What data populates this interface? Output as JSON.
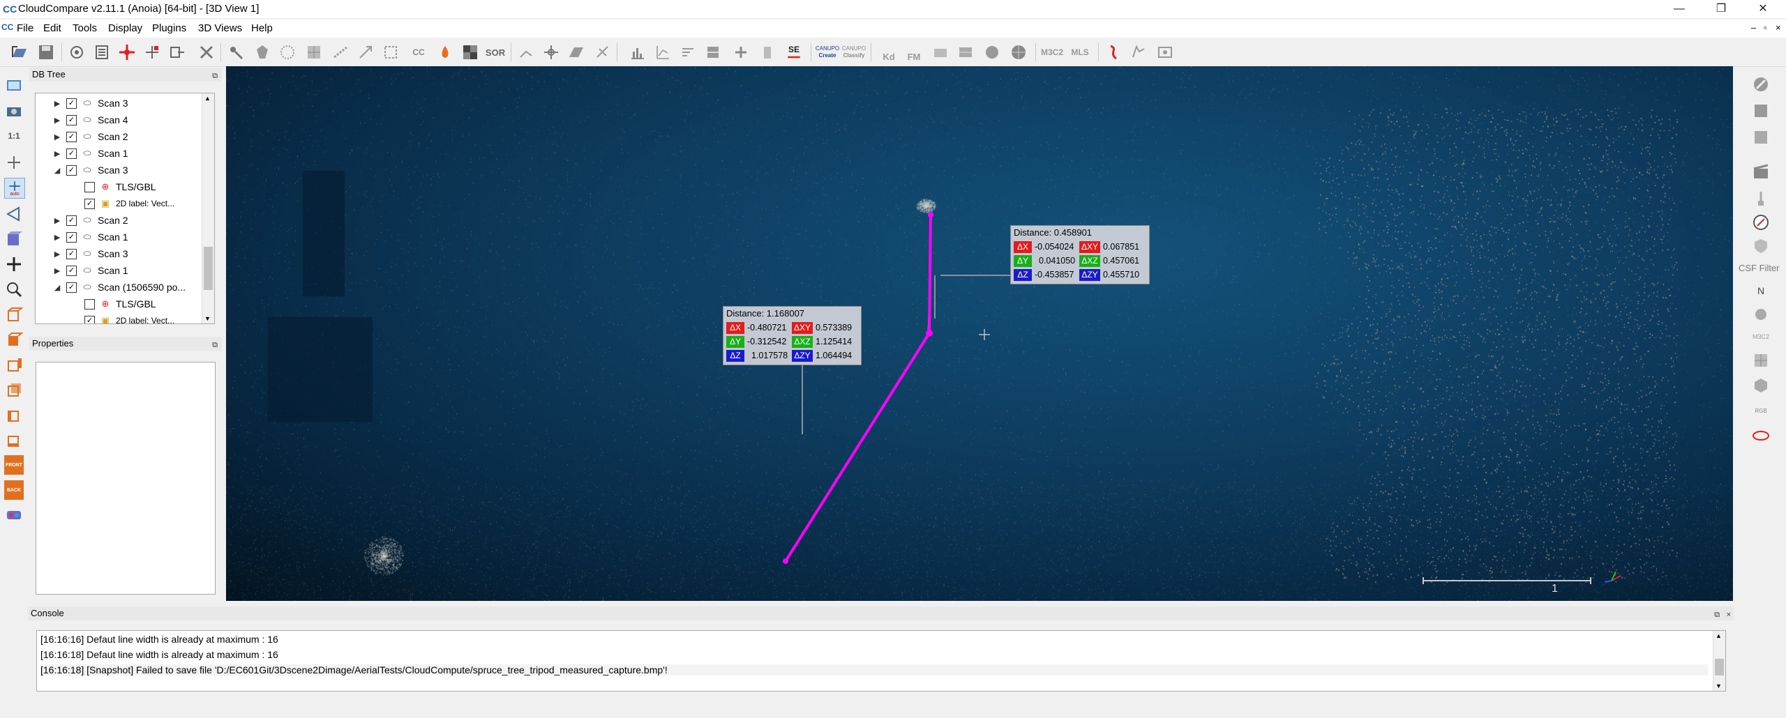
{
  "window": {
    "title": "CloudCompare v2.11.1 (Anoia) [64-bit] - [3D View 1]",
    "app_icon": "CC",
    "minimize": "—",
    "maximize": "❐",
    "close": "✕"
  },
  "menu": {
    "items": [
      "File",
      "Edit",
      "Tools",
      "Display",
      "Plugins",
      "3D Views",
      "Help"
    ],
    "mdi_icon": "CC",
    "mdi_minimize": "–",
    "mdi_restore": "▫",
    "mdi_close": "×"
  },
  "toolbar": {
    "sor": "SOR",
    "se": "SE",
    "canupo_create_title": "CANUPO",
    "canupo_create": "Create",
    "canupo_classify_title": "CANUPO",
    "canupo_classify": "Classify",
    "kd": "Kd",
    "fm": "FM",
    "m3c2": "M3C2",
    "mls": "MLS",
    "cc": "CC"
  },
  "left_toolbar": {
    "scale_1_1": "1:1",
    "auto": "auto",
    "front": "FRONT",
    "back": "BACK"
  },
  "db_tree": {
    "title": "DB Tree",
    "undock": "⧉",
    "rows": [
      {
        "label": "Scan 3",
        "level": 0,
        "expanded": false,
        "checked": true,
        "icon": "cloud"
      },
      {
        "label": "Scan 4",
        "level": 0,
        "expanded": false,
        "checked": true,
        "icon": "cloud"
      },
      {
        "label": "Scan 2",
        "level": 0,
        "expanded": false,
        "checked": true,
        "icon": "cloud"
      },
      {
        "label": "Scan 1",
        "level": 0,
        "expanded": false,
        "checked": true,
        "icon": "cloud"
      },
      {
        "label": "Scan 3",
        "level": 0,
        "expanded": true,
        "checked": true,
        "icon": "cloud"
      },
      {
        "label": "TLS/GBL",
        "level": 1,
        "expanded": null,
        "checked": false,
        "icon": "sensor"
      },
      {
        "label": "2D label: Vect...",
        "level": 1,
        "expanded": null,
        "checked": true,
        "icon": "label"
      },
      {
        "label": "Scan 2",
        "level": 0,
        "expanded": false,
        "checked": true,
        "icon": "cloud"
      },
      {
        "label": "Scan 1",
        "level": 0,
        "expanded": false,
        "checked": true,
        "icon": "cloud"
      },
      {
        "label": "Scan 3",
        "level": 0,
        "expanded": false,
        "checked": true,
        "icon": "cloud"
      },
      {
        "label": "Scan 1",
        "level": 0,
        "expanded": false,
        "checked": true,
        "icon": "cloud"
      },
      {
        "label": "Scan (1506590 po...",
        "level": 0,
        "expanded": true,
        "checked": true,
        "icon": "cloud"
      },
      {
        "label": "TLS/GBL",
        "level": 1,
        "expanded": null,
        "checked": false,
        "icon": "sensor"
      },
      {
        "label": "2D label: Vect...",
        "level": 1,
        "expanded": null,
        "checked": true,
        "icon": "label"
      }
    ]
  },
  "properties": {
    "title": "Properties",
    "undock": "⧉"
  },
  "view3d": {
    "label_left": {
      "title": "Distance: 1.168007",
      "dx": "-0.480721",
      "dxy": "0.573389",
      "dy": "-0.312542",
      "dxz": "1.125414",
      "dz": "1.017578",
      "dzy": "1.064494"
    },
    "label_right": {
      "title": "Distance: 0.458901",
      "dx": "-0.054024",
      "dxy": "0.067851",
      "dy": "0.041050",
      "dxz": "0.457061",
      "dz": "-0.453857",
      "dzy": "0.455710"
    },
    "tags": {
      "dx": "ΔX",
      "dy": "ΔY",
      "dz": "ΔZ",
      "dxy": "ΔXY",
      "dxz": "ΔXZ",
      "dzy": "ΔZY"
    },
    "scale_label": "1",
    "colors": {
      "measure_line": "#ff00ff",
      "x_tag": "#e31c1c",
      "y_tag": "#18b018",
      "z_tag": "#1a1acc"
    }
  },
  "right_toolbar": {
    "csf_filter": "CSF Filter",
    "north": "N",
    "m3c2": "M3C2",
    "rgb": "RGB"
  },
  "console": {
    "title": "Console",
    "undock": "⧉",
    "close": "×",
    "lines": [
      "[16:16:16] Defaut line width is already at maximum : 16",
      "[16:16:18] Defaut line width is already at maximum : 16",
      "[16:16:18] [Snapshot] Failed to save file 'D:/EC601Git/3Dscene2Dimage/AerialTests/CloudCompute/spruce_tree_tripod_measured_capture.bmp'!"
    ]
  }
}
